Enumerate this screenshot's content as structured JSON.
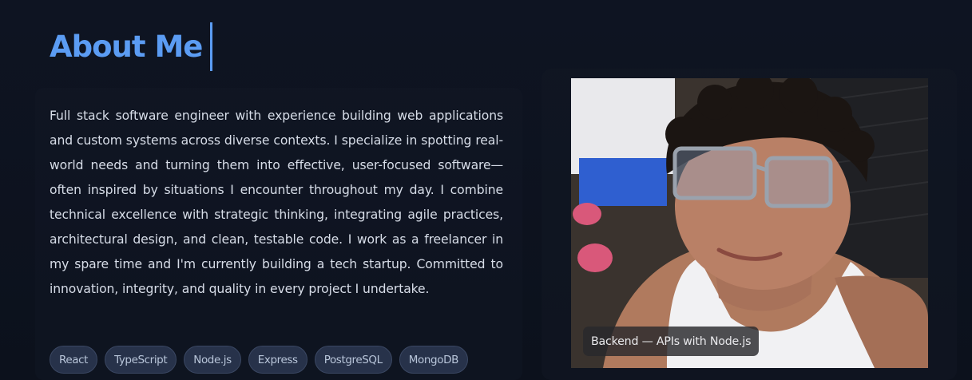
{
  "about": {
    "title": "About Me",
    "bio": "Full stack software engineer with experience building web applications and custom systems across diverse contexts. I specialize in spotting real-world needs and turning them into effective, user-focused software—often inspired by situations I encounter throughout my day. I combine technical excellence with strategic thinking, integrating agile practices, architectural design, and clean, testable code. I work as a freelancer in my spare time and I'm currently building a tech startup. Committed to innovation, integrity, and quality in every project I undertake.",
    "tags": [
      "React",
      "TypeScript",
      "Node.js",
      "Express",
      "PostgreSQL",
      "MongoDB"
    ]
  },
  "photo": {
    "caption": "Backend — APIs with Node.js"
  },
  "colors": {
    "accent": "#5b9cf3",
    "background": "#0d131f",
    "tag_bg": "#27324a"
  }
}
